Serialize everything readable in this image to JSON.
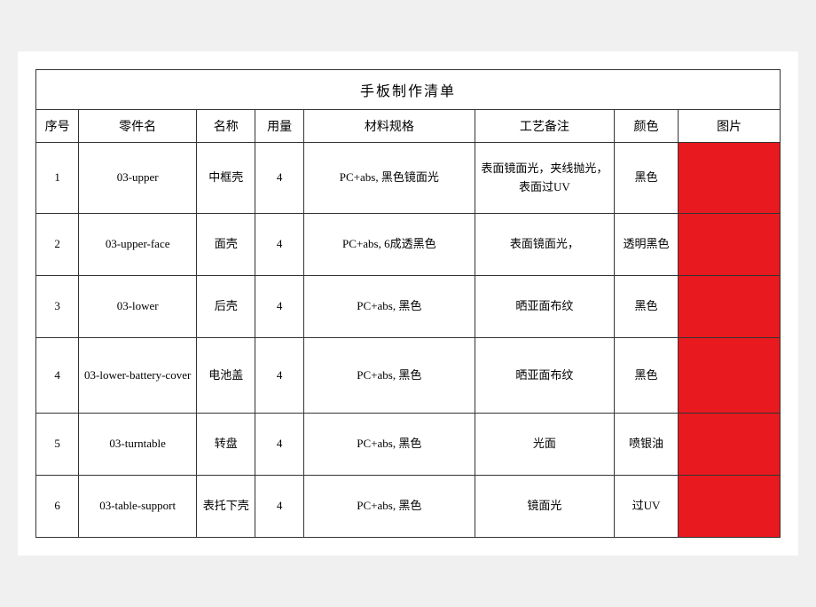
{
  "title": "手板制作清单",
  "headers": {
    "seq": "序号",
    "part": "零件名",
    "name": "名称",
    "qty": "用量",
    "spec": "材料规格",
    "process": "工艺备注",
    "color": "颜色",
    "image": "图片"
  },
  "rows": [
    {
      "seq": "1",
      "part": "03-upper",
      "name": "中框壳",
      "qty": "4",
      "spec": "PC+abs, 黑色镜面光",
      "process": "表面镜面光，夹线抛光，表面过UV",
      "color": "黑色"
    },
    {
      "seq": "2",
      "part": "03-upper-face",
      "name": "面壳",
      "qty": "4",
      "spec": "PC+abs, 6成透黑色",
      "process": "表面镜面光，",
      "color": "透明黑色"
    },
    {
      "seq": "3",
      "part": "03-lower",
      "name": "后壳",
      "qty": "4",
      "spec": "PC+abs, 黑色",
      "process": "晒亚面布纹",
      "color": "黑色"
    },
    {
      "seq": "4",
      "part": "03-lower-battery-cover",
      "name": "电池盖",
      "qty": "4",
      "spec": "PC+abs, 黑色",
      "process": "晒亚面布纹",
      "color": "黑色"
    },
    {
      "seq": "5",
      "part": "03-turntable",
      "name": "转盘",
      "qty": "4",
      "spec": "PC+abs, 黑色",
      "process": "光面",
      "color": "喷银油"
    },
    {
      "seq": "6",
      "part": "03-table-support",
      "name": "表托下壳",
      "qty": "4",
      "spec": "PC+abs, 黑色",
      "process": "镜面光",
      "color": "过UV"
    }
  ]
}
